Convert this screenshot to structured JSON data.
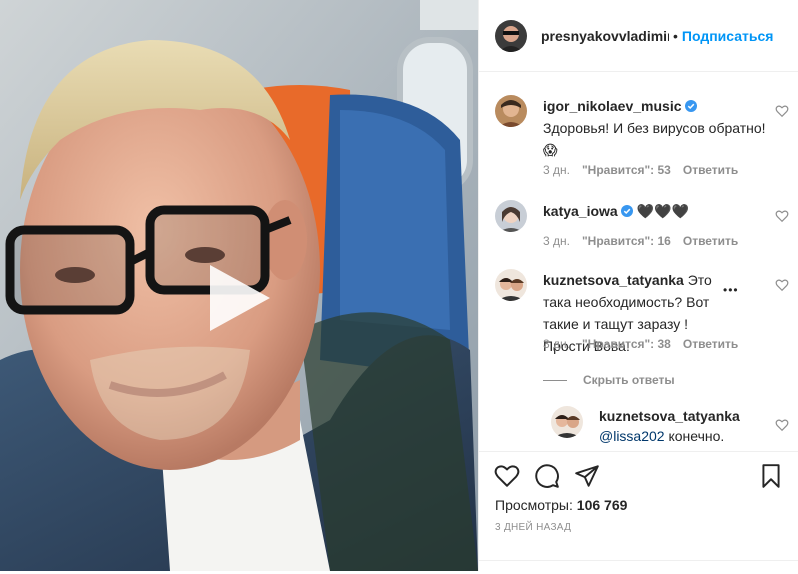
{
  "post": {
    "author": {
      "username": "presnyakovvladimir",
      "follow_label": "Подписаться",
      "separator": "•"
    },
    "media": {
      "type": "video",
      "play_icon": "play-icon"
    },
    "comments": [
      {
        "username": "igor_nikolaev_music",
        "verified": true,
        "text": "Здоровья! И без вирусов обратно!😱",
        "time": "3 дн.",
        "likes": "\"Нравится\": 53",
        "reply_label": "Ответить"
      },
      {
        "username": "katya_iowa",
        "verified": true,
        "text": "🖤🖤🖤",
        "time": "3 дн.",
        "likes": "\"Нравится\": 16",
        "reply_label": "Ответить"
      },
      {
        "username": "kuznetsova_tatyanka",
        "verified": false,
        "text": "Это така необходимость? Вот такие и тащут заразу ! Прости Вова!",
        "time": "3 дн.",
        "likes": "\"Нравится\": 38",
        "reply_label": "Ответить",
        "more_label": "•••"
      }
    ],
    "hide_replies_label": "Скрыть ответы",
    "reply": {
      "username": "kuznetsova_tatyanka",
      "mention": "@lissa202",
      "text": "конечно."
    },
    "views_label": "Просмотры:",
    "views_count": "106 769",
    "date": "3 ДНЕЙ НАЗАД"
  },
  "colors": {
    "link": "#0095f6",
    "muted": "#8e8e8e",
    "text": "#262626"
  }
}
